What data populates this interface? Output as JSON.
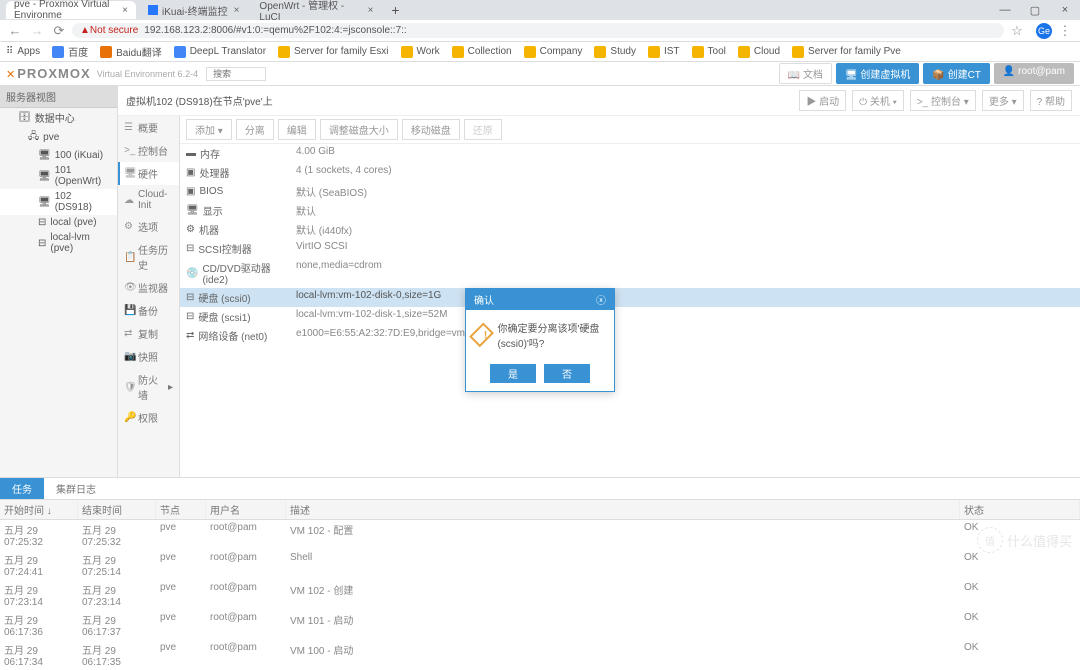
{
  "browser": {
    "tabs": [
      {
        "title": "pve - Proxmox Virtual Environme",
        "active": true
      },
      {
        "title": "iKuai-终端监控",
        "active": false
      },
      {
        "title": "OpenWrt - 管理权 - LuCI",
        "active": false
      }
    ],
    "url": "192.168.123.2:8006/#v1:0:=qemu%2F102:4:=jsconsole::7::",
    "insecure": "Not secure",
    "bookmarks": [
      "Apps",
      "百度",
      "Baidu翻译",
      "DeepL Translator",
      "Server for family Esxi",
      "Work",
      "Collection",
      "Company",
      "Study",
      "IST",
      "Tool",
      "Cloud",
      "Server for family Pve"
    ],
    "avatar": "Ge"
  },
  "proxmox": {
    "brand": "PROXMOX",
    "version": "Virtual Environment 6.2-4",
    "search_ph": "搜索",
    "header_buttons": {
      "docs": "文档",
      "create_vm": "创建虚拟机",
      "create_ct": "创建CT",
      "user": "root@pam"
    }
  },
  "tree": {
    "header": "服务器视图",
    "items": [
      {
        "label": "数据中心",
        "lvl": 1
      },
      {
        "label": "pve",
        "lvl": 2
      },
      {
        "label": "100 (iKuai)",
        "lvl": 3
      },
      {
        "label": "101 (OpenWrt)",
        "lvl": 3
      },
      {
        "label": "102 (DS918)",
        "lvl": 3,
        "selected": true
      },
      {
        "label": "local (pve)",
        "lvl": 3
      },
      {
        "label": "local-lvm (pve)",
        "lvl": 3
      }
    ]
  },
  "content": {
    "title": "虚拟机102 (DS918)在节点'pve'上",
    "header_btns": {
      "start": "启动",
      "shutdown": "关机",
      "console": "控制台",
      "more": "更多",
      "help": "帮助"
    }
  },
  "sidebar": {
    "items": [
      {
        "label": "概要",
        "icon": "☰"
      },
      {
        "label": "控制台",
        "icon": ">_"
      },
      {
        "label": "硬件",
        "icon": "🖥",
        "active": true
      },
      {
        "label": "Cloud-Init",
        "icon": "☁"
      },
      {
        "label": "选项",
        "icon": "⚙"
      },
      {
        "label": "任务历史",
        "icon": "📋"
      },
      {
        "label": "监视器",
        "icon": "👁"
      },
      {
        "label": "备份",
        "icon": "💾"
      },
      {
        "label": "复制",
        "icon": "⇄"
      },
      {
        "label": "快照",
        "icon": "📷"
      },
      {
        "label": "防火墙",
        "icon": "🛡"
      },
      {
        "label": "权限",
        "icon": "🔑"
      }
    ]
  },
  "hw": {
    "toolbar": [
      "添加",
      "分离",
      "编辑",
      "调整磁盘大小",
      "移动磁盘",
      "还原"
    ],
    "rows": [
      {
        "k": "内存",
        "v": "4.00 GiB"
      },
      {
        "k": "处理器",
        "v": "4 (1 sockets, 4 cores)"
      },
      {
        "k": "BIOS",
        "v": "默认 (SeaBIOS)"
      },
      {
        "k": "显示",
        "v": "默认"
      },
      {
        "k": "机器",
        "v": "默认 (i440fx)"
      },
      {
        "k": "SCSI控制器",
        "v": "VirtIO SCSI"
      },
      {
        "k": "CD/DVD驱动器 (ide2)",
        "v": "none,media=cdrom"
      },
      {
        "k": "硬盘 (scsi0)",
        "v": "local-lvm:vm-102-disk-0,size=1G",
        "selected": true
      },
      {
        "k": "硬盘 (scsi1)",
        "v": "local-lvm:vm-102-disk-1,size=52M"
      },
      {
        "k": "网络设备 (net0)",
        "v": "e1000=E6:55:A2:32:7D:E9,bridge=vmbr0,firewall=1"
      }
    ]
  },
  "dialog": {
    "title": "确认",
    "msg": "你确定要分离该项'硬盘 (scsi0)'吗?",
    "yes": "是",
    "no": "否"
  },
  "log": {
    "tabs": [
      "任务",
      "集群日志"
    ],
    "cols": [
      "开始时间 ↓",
      "结束时间",
      "节点",
      "用户名",
      "描述",
      "状态"
    ],
    "rows": [
      {
        "t1": "五月 29 07:25:32",
        "t2": "五月 29 07:25:32",
        "n": "pve",
        "u": "root@pam",
        "d": "VM 102 - 配置",
        "s": "OK"
      },
      {
        "t1": "五月 29 07:24:41",
        "t2": "五月 29 07:25:14",
        "n": "pve",
        "u": "root@pam",
        "d": "Shell",
        "s": "OK"
      },
      {
        "t1": "五月 29 07:23:14",
        "t2": "五月 29 07:23:14",
        "n": "pve",
        "u": "root@pam",
        "d": "VM 102 - 创建",
        "s": "OK"
      },
      {
        "t1": "五月 29 06:17:36",
        "t2": "五月 29 06:17:37",
        "n": "pve",
        "u": "root@pam",
        "d": "VM 101 - 启动",
        "s": "OK"
      },
      {
        "t1": "五月 29 06:17:34",
        "t2": "五月 29 06:17:35",
        "n": "pve",
        "u": "root@pam",
        "d": "VM 100 - 启动",
        "s": "OK"
      }
    ]
  },
  "watermark": {
    "circle": "值",
    "text": "什么值得买"
  }
}
